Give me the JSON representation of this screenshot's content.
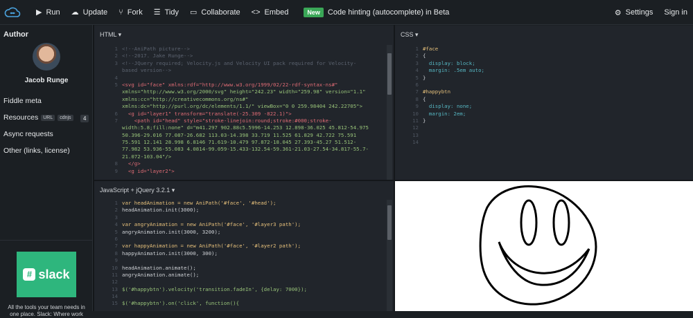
{
  "topbar": {
    "run": "Run",
    "update": "Update",
    "fork": "Fork",
    "tidy": "Tidy",
    "collaborate": "Collaborate",
    "embed": "Embed",
    "badge": "New",
    "beta_text": "Code hinting (autocomplete) in Beta",
    "settings": "Settings",
    "signin": "Sign in"
  },
  "sidebar": {
    "author_heading": "Author",
    "author_name": "Jacob Runge",
    "fiddle_meta": "Fiddle meta",
    "resources": "Resources",
    "chip_url": "URL",
    "chip_cdnjs": "cdnjs",
    "resources_count": "4",
    "async": "Async requests",
    "other": "Other (links, license)",
    "ad_brand": "slack",
    "ad_text": "All the tools your team needs in one place. Slack: Where work"
  },
  "panes": {
    "html_title": "HTML ▾",
    "css_title": "CSS ▾",
    "js_title": "JavaScript + jQuery 3.2.1 ▾"
  },
  "html_lines": [
    "<!--AniPath picture-->",
    "<!--2017. Jake Runge-->",
    "<!--JQuery required; Velocity.js and Velocity UI pack required for Velocity-",
    "based version-->",
    "",
    "<svg id=\"face\" xmlns:rdf=\"http://www.w3.org/1999/02/22-rdf-syntax-ns#\"",
    "xmlns=\"http://www.w3.org/2000/svg\" height=\"242.23\" width=\"259.98\" version=\"1.1\"",
    "xmlns:cc=\"http://creativecommons.org/ns#\"",
    "xmlns:dc=\"http://purl.org/dc/elements/1.1/\" viewBox=\"0 0 259.98404 242.22705\">",
    "  <g id=\"layer1\" transform=\"translate(-25.309 -822.1)\">",
    "    <path id=\"head\" style=\"stroke-linejoin:round;stroke:#000;stroke-",
    "width:5.8;fill:none\" d=\"m41.297 902.88c5.5996-14.253 12.898-36.025 45.812-54.975",
    "50.396-29.016 77.087-26.682 113.03-14.398 33.719 11.525 61.829 42.722 75.591",
    "75.591 12.141 28.998 6.8146 71.619-10.479 97.872-18.045 27.393-45.27 51.512-",
    "77.982 53.936-55.083 4.0814-99.059-15.433-132.54-59.361-21.03-27.54-34.817-55.7-",
    "21.072-103.04\"/>",
    "  </g>",
    "  <g id=\"layer2\">"
  ],
  "html_gutter": [
    "1",
    "2",
    "3",
    "",
    "4",
    "5",
    "",
    "",
    "",
    "6",
    "7",
    "",
    "",
    "",
    "",
    "",
    "8",
    "9"
  ],
  "css_lines": [
    "#face",
    "{",
    "  display: block;",
    "  margin: .5em auto;",
    "}",
    "",
    "#happybtn",
    "{",
    "  display: none;",
    "  margin: 2em;",
    "}",
    "",
    "",
    ""
  ],
  "css_gutter": [
    "1",
    "2",
    "3",
    "4",
    "5",
    "6",
    "7",
    "8",
    "9",
    "10",
    "11",
    "12",
    "13",
    "14"
  ],
  "js_lines": [
    "var headAnimation = new AniPath('#face', '#head');",
    "headAnimation.init(3000);",
    "",
    "var angryAnimation = new AniPath('#face', '#layer3 path');",
    "angryAnimation.init(3000, 3200);",
    "",
    "var happyAnimation = new AniPath('#face', '#layer2 path');",
    "happyAnimation.init(3000, 300);",
    "",
    "headAnimation.animate();",
    "angryAnimation.animate();",
    "",
    "$('#happybtn').velocity('transition.fadeIn', {delay: 7000});",
    "",
    "$('#happybtn').on('click', function(){"
  ],
  "js_gutter": [
    "1",
    "2",
    "3",
    "4",
    "5",
    "6",
    "7",
    "8",
    "9",
    "10",
    "11",
    "12",
    "13",
    "14",
    "15"
  ],
  "colors": {
    "comment": "#5c6370",
    "tag": "#e06c75",
    "attr": "#d19a66",
    "string": "#98c379",
    "keyword": "#c678dd",
    "number": "#d19a66",
    "css_selector": "#e5c07b",
    "css_value": "#56b6c2"
  }
}
